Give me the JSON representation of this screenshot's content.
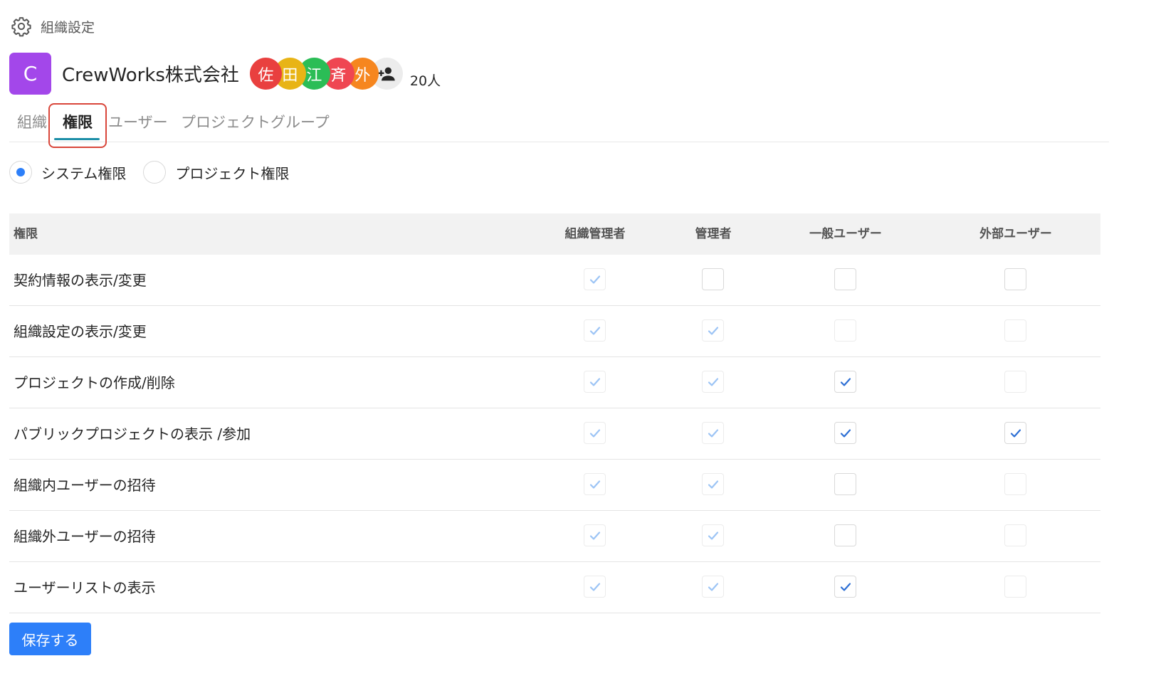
{
  "breadcrumb": {
    "icon": "gear-icon",
    "label": "組織設定"
  },
  "organization": {
    "logo_letter": "C",
    "logo_color": "#a347ea",
    "name": "CrewWorks株式会社",
    "members": [
      {
        "initial": "佐",
        "color": "#e9403f"
      },
      {
        "initial": "田",
        "color": "#e8b416"
      },
      {
        "initial": "江",
        "color": "#2bbd56"
      },
      {
        "initial": "斉",
        "color": "#ef4652"
      },
      {
        "initial": "外",
        "color": "#f6861f"
      }
    ],
    "add_member_icon": "person-add-icon",
    "member_count": "20人"
  },
  "tabs": [
    {
      "label": "組織",
      "active": false
    },
    {
      "label": "権限",
      "active": true
    },
    {
      "label": "ユーザー",
      "active": false
    },
    {
      "label": "プロジェクトグループ",
      "active": false
    }
  ],
  "permission_type": {
    "options": [
      {
        "label": "システム権限",
        "selected": true
      },
      {
        "label": "プロジェクト権限",
        "selected": false
      }
    ]
  },
  "table": {
    "headers": [
      "権限",
      "組織管理者",
      "管理者",
      "一般ユーザー",
      "外部ユーザー"
    ],
    "rows": [
      {
        "label": "契約情報の表示/変更",
        "cells": [
          {
            "checked": true,
            "disabled": true
          },
          {
            "checked": false,
            "disabled": false
          },
          {
            "checked": false,
            "disabled": false
          },
          {
            "checked": false,
            "disabled": false
          }
        ]
      },
      {
        "label": "組織設定の表示/変更",
        "cells": [
          {
            "checked": true,
            "disabled": true
          },
          {
            "checked": true,
            "disabled": true
          },
          {
            "checked": false,
            "disabled": true
          },
          {
            "checked": false,
            "disabled": true
          }
        ]
      },
      {
        "label": "プロジェクトの作成/削除",
        "cells": [
          {
            "checked": true,
            "disabled": true
          },
          {
            "checked": true,
            "disabled": true
          },
          {
            "checked": true,
            "disabled": false
          },
          {
            "checked": false,
            "disabled": true
          }
        ]
      },
      {
        "label": "パブリックプロジェクトの表示 /参加",
        "cells": [
          {
            "checked": true,
            "disabled": true
          },
          {
            "checked": true,
            "disabled": true
          },
          {
            "checked": true,
            "disabled": false
          },
          {
            "checked": true,
            "disabled": false
          }
        ]
      },
      {
        "label": "組織内ユーザーの招待",
        "cells": [
          {
            "checked": true,
            "disabled": true
          },
          {
            "checked": true,
            "disabled": true
          },
          {
            "checked": false,
            "disabled": false
          },
          {
            "checked": false,
            "disabled": true
          }
        ]
      },
      {
        "label": "組織外ユーザーの招待",
        "cells": [
          {
            "checked": true,
            "disabled": true
          },
          {
            "checked": true,
            "disabled": true
          },
          {
            "checked": false,
            "disabled": false
          },
          {
            "checked": false,
            "disabled": true
          }
        ]
      },
      {
        "label": "ユーザーリストの表示",
        "cells": [
          {
            "checked": true,
            "disabled": true
          },
          {
            "checked": true,
            "disabled": true
          },
          {
            "checked": true,
            "disabled": false
          },
          {
            "checked": false,
            "disabled": true
          }
        ]
      }
    ]
  },
  "save_button": {
    "label": "保存する",
    "color": "#2d7ff9"
  }
}
